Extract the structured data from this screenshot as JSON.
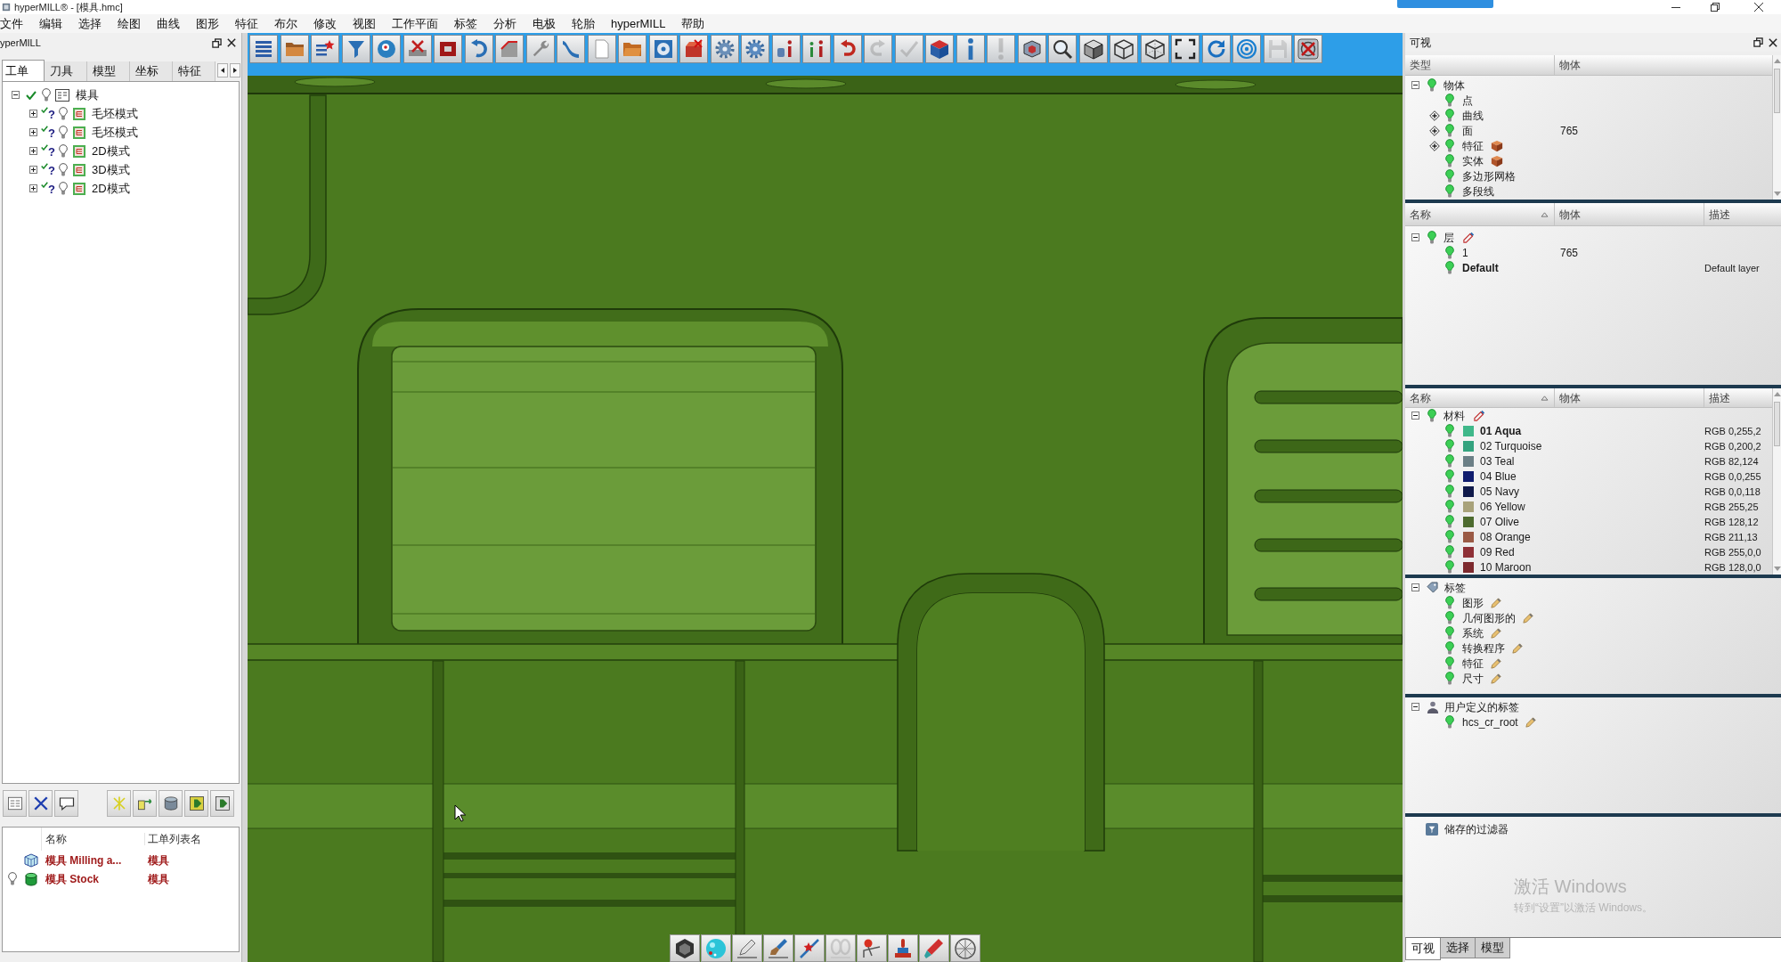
{
  "window": {
    "title": "hyperMILL® - [模具.hmc]"
  },
  "menu": [
    "文件",
    "编辑",
    "选择",
    "绘图",
    "曲线",
    "图形",
    "特征",
    "布尔",
    "修改",
    "视图",
    "工作平面",
    "标签",
    "分析",
    "电极",
    "轮胎",
    "hyperMILL",
    "帮助"
  ],
  "job_panel": {
    "title": "yperMILL",
    "tabs": [
      {
        "label": "工单",
        "selected": true
      },
      {
        "label": "刀具",
        "selected": false
      },
      {
        "label": "模型",
        "selected": false
      },
      {
        "label": "坐标",
        "selected": false
      },
      {
        "label": "特征",
        "selected": false
      }
    ],
    "tree": {
      "label": "模具",
      "checked": true,
      "expanded": true,
      "children": [
        {
          "label": "毛坯模式",
          "status": "?",
          "checked": true,
          "expanded": false
        },
        {
          "label": "毛坯模式",
          "status": "?",
          "checked": true,
          "expanded": false
        },
        {
          "label": "2D模式",
          "status": "?",
          "checked": true,
          "expanded": false
        },
        {
          "label": "3D模式",
          "status": "?",
          "checked": true,
          "expanded": false
        },
        {
          "label": "2D模式",
          "status": "?",
          "checked": true,
          "expanded": false
        }
      ]
    },
    "objects": {
      "columns": [
        "名称",
        "工单列表名"
      ],
      "rows": [
        {
          "kind": "milling",
          "visible": false,
          "name": "模具 Milling a...",
          "job_list": "模具"
        },
        {
          "kind": "stock",
          "visible": true,
          "name": "模具 Stock",
          "job_list": "模具"
        }
      ]
    }
  },
  "toolbar": [
    {
      "disabled": false
    },
    {
      "disabled": false
    },
    {
      "disabled": false
    },
    {
      "disabled": false
    },
    {
      "disabled": false
    },
    {
      "disabled": false
    },
    {
      "disabled": false
    },
    {
      "disabled": false
    },
    {
      "disabled": false
    },
    {
      "disabled": false
    },
    {
      "disabled": false
    },
    {
      "disabled": false
    },
    {
      "disabled": false
    },
    {
      "disabled": false
    },
    {
      "disabled": false
    },
    {
      "disabled": false
    },
    {
      "disabled": false
    },
    {
      "disabled": false
    },
    {
      "disabled": false
    },
    {
      "disabled": false
    },
    {
      "disabled": true
    },
    {
      "disabled": true
    },
    {
      "disabled": false
    },
    {
      "disabled": false
    },
    {
      "disabled": true
    },
    {
      "disabled": false
    },
    {
      "disabled": false
    },
    {
      "disabled": false
    },
    {
      "disabled": false
    },
    {
      "disabled": false
    },
    {
      "disabled": false
    },
    {
      "disabled": false
    },
    {
      "disabled": false
    },
    {
      "disabled": true
    },
    {
      "disabled": false
    }
  ],
  "view_toolbar": [
    {
      "disabled": false
    },
    {
      "disabled": false
    },
    {
      "disabled": false
    },
    {
      "disabled": false
    },
    {
      "disabled": false
    },
    {
      "disabled": true
    },
    {
      "disabled": false
    },
    {
      "disabled": false
    },
    {
      "disabled": false
    },
    {
      "disabled": false
    }
  ],
  "visibility_panel": {
    "title": "可视",
    "types": {
      "columns": [
        {
          "label": "类型",
          "sorted": false
        },
        {
          "label": "物体",
          "sorted": false
        }
      ],
      "root": {
        "label": "物体",
        "visible": true,
        "expanded": true,
        "children": [
          {
            "kind": "leaf",
            "label": "点",
            "visible": true,
            "solid": false
          },
          {
            "kind": "group",
            "label": "曲线",
            "visible": true,
            "expanded": false,
            "solid": false
          },
          {
            "kind": "group",
            "label": "面",
            "visible": true,
            "expanded": false,
            "solid": false,
            "count": "765"
          },
          {
            "kind": "group",
            "label": "特征",
            "visible": true,
            "expanded": false,
            "solid": true
          },
          {
            "kind": "leaf",
            "label": "实体",
            "visible": true,
            "solid": true
          },
          {
            "kind": "leaf",
            "label": "多边形网格",
            "visible": true,
            "solid": false
          },
          {
            "kind": "leaf",
            "label": "多段线",
            "visible": true,
            "solid": false
          }
        ]
      }
    },
    "layers": {
      "columns": [
        {
          "label": "名称",
          "sorted": true
        },
        {
          "label": "物体",
          "sorted": false
        },
        {
          "label": "描述",
          "sorted": false
        }
      ],
      "root": {
        "label": "层",
        "visible": true,
        "expanded": true,
        "children": [
          {
            "label": "1",
            "visible": true,
            "active": false,
            "count": "765"
          },
          {
            "label": "Default",
            "visible": true,
            "active": true,
            "description": "Default layer"
          }
        ]
      }
    },
    "materials": {
      "columns": [
        {
          "label": "名称",
          "sorted": true
        },
        {
          "label": "物体",
          "sorted": false
        },
        {
          "label": "描述",
          "sorted": false
        }
      ],
      "root": {
        "label": "材料",
        "visible": true,
        "expanded": true,
        "children": [
          {
            "label": "01 Aqua",
            "visible": true,
            "active": true,
            "color": "#3fb88a",
            "description": "RGB 0,255,2"
          },
          {
            "label": "02 Turquoise",
            "visible": true,
            "active": false,
            "color": "#34a37f",
            "description": "RGB 0,200,2"
          },
          {
            "label": "03 Teal",
            "visible": true,
            "active": false,
            "color": "#6b7f86",
            "description": "RGB 82,124"
          },
          {
            "label": "04 Blue",
            "visible": true,
            "active": false,
            "color": "#0f1c6e",
            "description": "RGB 0,0,255"
          },
          {
            "label": "05 Navy",
            "visible": true,
            "active": false,
            "color": "#101a4a",
            "description": "RGB 0,0,118"
          },
          {
            "label": "06 Yellow",
            "visible": true,
            "active": false,
            "color": "#a8a27a",
            "description": "RGB 255,25"
          },
          {
            "label": "07 Olive",
            "visible": true,
            "active": false,
            "color": "#4d6b2f",
            "description": "RGB 128,12"
          },
          {
            "label": "08 Orange",
            "visible": true,
            "active": false,
            "color": "#9a5a45",
            "description": "RGB 211,13"
          },
          {
            "label": "09 Red",
            "visible": true,
            "active": false,
            "color": "#8e3036",
            "description": "RGB 255,0,0"
          },
          {
            "label": "10 Maroon",
            "visible": true,
            "active": false,
            "color": "#7d2a2e",
            "description": "RGB 128,0,0"
          }
        ]
      }
    },
    "tags": {
      "label": "标签",
      "expanded": true,
      "children": [
        {
          "label": "图形",
          "visible": true
        },
        {
          "label": "几何图形的",
          "visible": true
        },
        {
          "label": "系统",
          "visible": true
        },
        {
          "label": "转换程序",
          "visible": true
        },
        {
          "label": "特征",
          "visible": true
        },
        {
          "label": "尺寸",
          "visible": true
        }
      ]
    },
    "user_tags": {
      "label": "用户定义的标签",
      "expanded": true,
      "children": [
        {
          "label": "hcs_cr_root",
          "visible": true
        }
      ]
    },
    "saved_filters": {
      "label": "储存的过滤器"
    },
    "tabs": [
      {
        "label": "可视",
        "selected": true
      },
      {
        "label": "选择",
        "selected": false
      },
      {
        "label": "模型",
        "selected": false
      }
    ]
  },
  "activation_notice": {
    "title": "激活 Windows",
    "hint": "转到“设置”以激活 Windows。"
  }
}
